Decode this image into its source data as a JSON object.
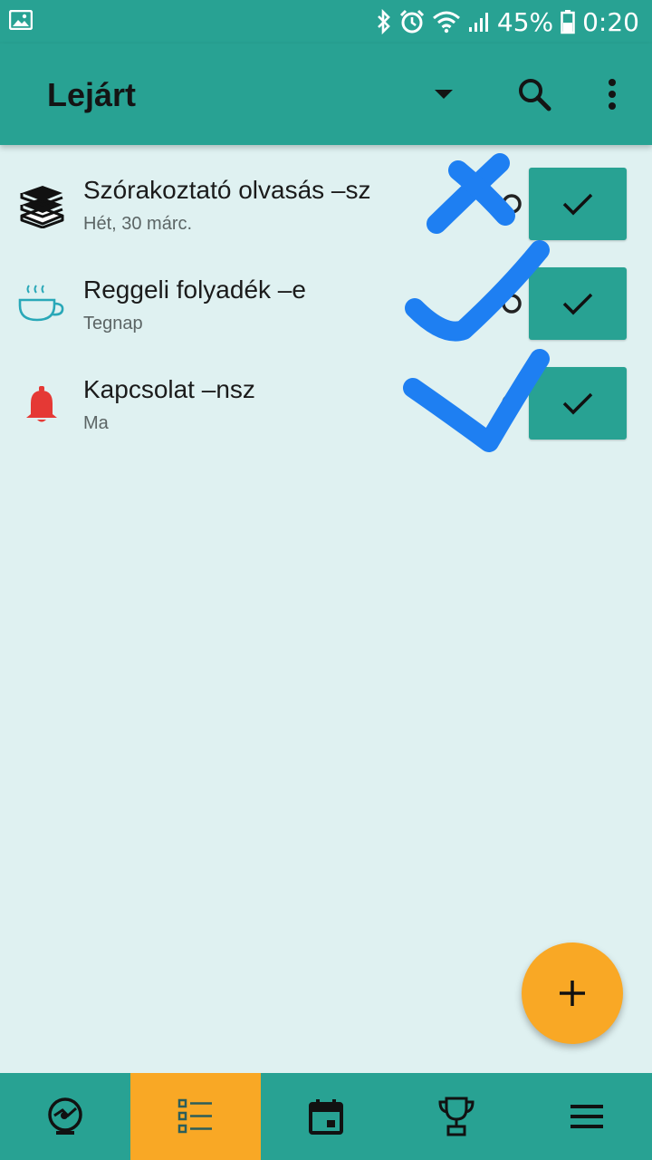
{
  "status_bar": {
    "battery_percent": "45%",
    "time": "0:20",
    "icons": [
      "image-icon",
      "bluetooth-icon",
      "alarm-icon",
      "wifi-icon",
      "signal-icon",
      "battery-icon"
    ]
  },
  "app_bar": {
    "title": "Lejárt",
    "icons": [
      "dropdown-arrow-icon",
      "search-icon",
      "more-vert-icon"
    ]
  },
  "tasks": [
    {
      "title": "Szórakoztató olvasás –sz",
      "date": "Hét, 30 márc.",
      "icon": "books-icon"
    },
    {
      "title": "Reggeli folyadék –e",
      "date": "Tegnap",
      "icon": "cup-icon"
    },
    {
      "title": "Kapcsolat –nsz",
      "date": "Ma",
      "icon": "bell-icon"
    }
  ],
  "bottom_nav": {
    "items": [
      "habits-icon",
      "task-list-icon",
      "calendar-icon",
      "trophy-icon",
      "menu-icon"
    ],
    "active": "task-list-icon"
  },
  "colors": {
    "primary": "#28a293",
    "accent": "#f9a825",
    "background": "#dff1f1",
    "scribble": "#1e7ff2",
    "bell": "#e53935",
    "cup": "#29a8b8"
  }
}
